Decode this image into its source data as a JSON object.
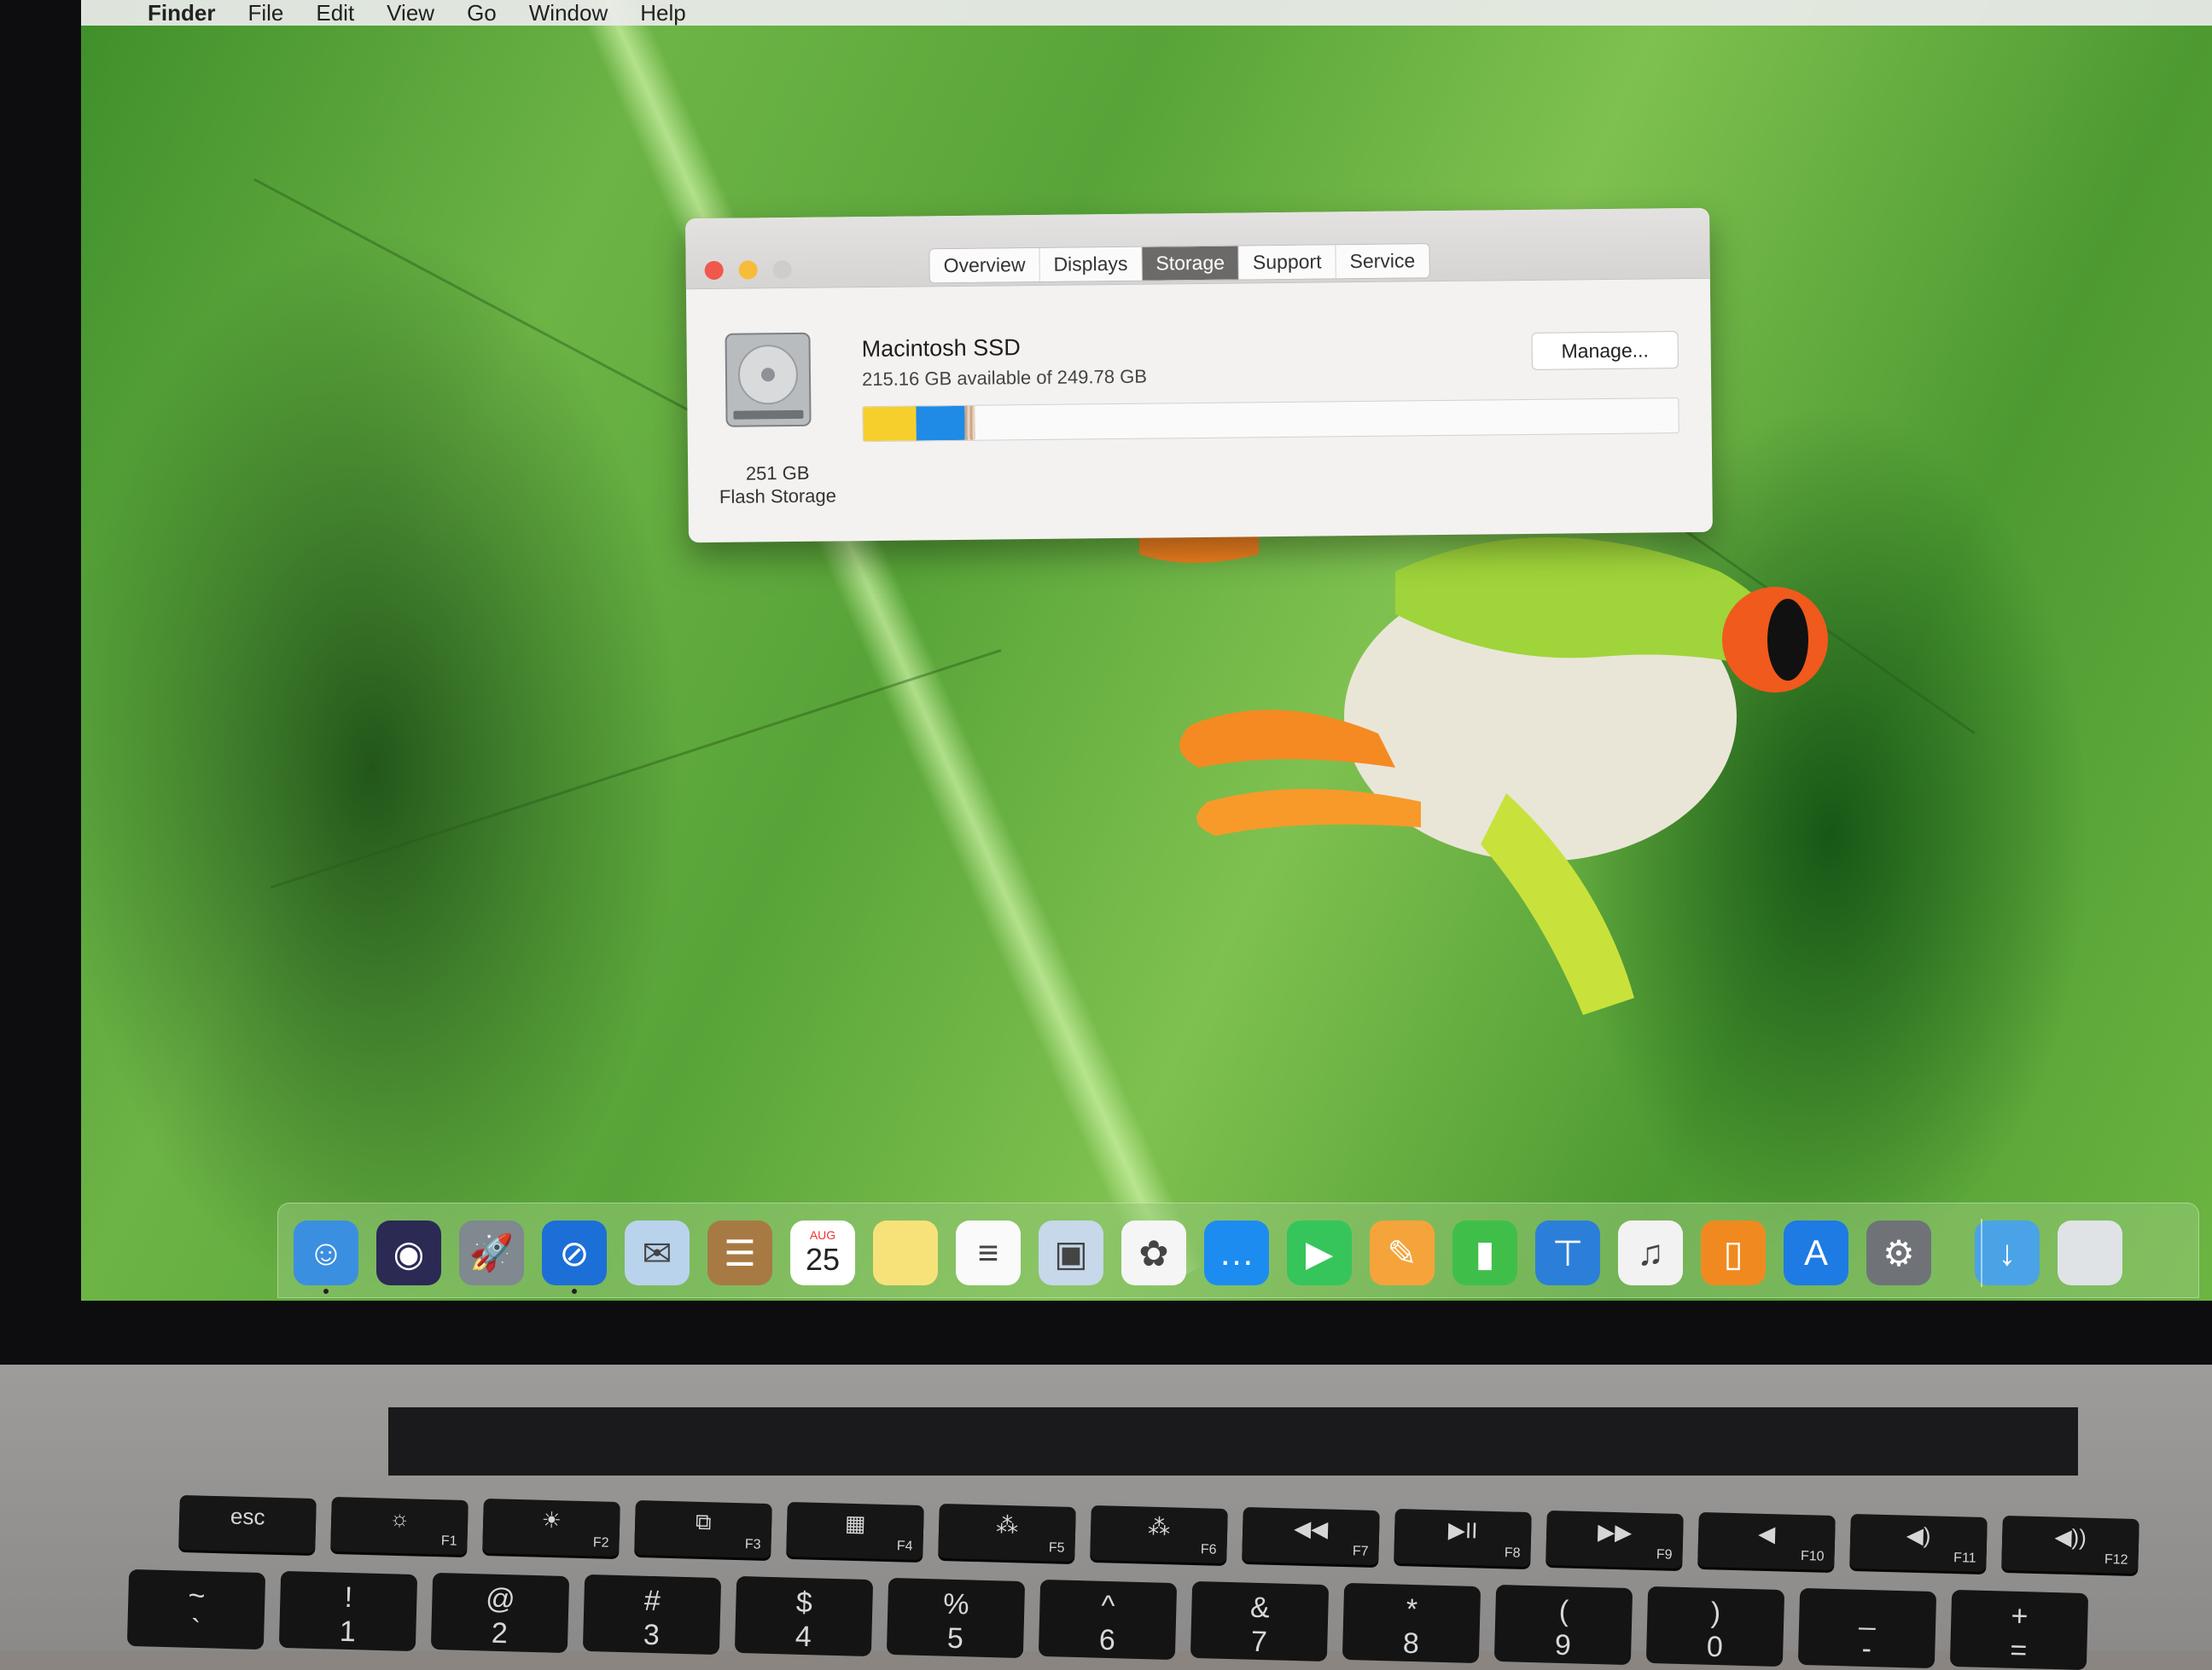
{
  "menubar": {
    "apple": "",
    "app_name": "Finder",
    "items": [
      "File",
      "Edit",
      "View",
      "Go",
      "Window",
      "Help"
    ]
  },
  "about_window": {
    "tabs": [
      "Overview",
      "Displays",
      "Storage",
      "Support",
      "Service"
    ],
    "active_tab": "Storage",
    "disk_size": "251 GB",
    "disk_type": "Flash Storage",
    "volume_name": "Macintosh SSD",
    "available_text": "215.16 GB available of 249.78 GB",
    "manage_label": "Manage...",
    "storage_usage": {
      "segments": [
        {
          "name": "yellow",
          "color": "#f7cf2d",
          "fraction": 0.065
        },
        {
          "name": "blue",
          "color": "#1f8be6",
          "fraction": 0.06
        },
        {
          "name": "other",
          "color": "#c9a98a",
          "fraction": 0.012
        }
      ],
      "free_fraction": 0.863
    }
  },
  "dock": {
    "apps": [
      {
        "name": "Finder",
        "icon": "finder-icon",
        "color": "#3b8fe0",
        "running": true
      },
      {
        "name": "Siri",
        "icon": "siri-icon",
        "color": "#2a2a55",
        "running": false
      },
      {
        "name": "Launchpad",
        "icon": "launchpad-icon",
        "color": "#808890",
        "running": false
      },
      {
        "name": "Safari",
        "icon": "safari-icon",
        "color": "#1c6fd6",
        "running": true
      },
      {
        "name": "Mail",
        "icon": "mail-icon",
        "color": "#b9d3ec",
        "running": false
      },
      {
        "name": "Contacts",
        "icon": "contacts-icon",
        "color": "#a87a43",
        "running": false
      },
      {
        "name": "Calendar",
        "icon": "calendar-icon",
        "color": "#ffffff",
        "running": false,
        "month": "AUG",
        "day": "25"
      },
      {
        "name": "Notes",
        "icon": "notes-icon",
        "color": "#f7e27a",
        "running": false
      },
      {
        "name": "Reminders",
        "icon": "reminders-icon",
        "color": "#fafafa",
        "running": false
      },
      {
        "name": "Photo Booth",
        "icon": "photobooth-icon",
        "color": "#c6d8ea",
        "running": false
      },
      {
        "name": "Photos",
        "icon": "photos-icon",
        "color": "#f5f5f5",
        "running": false
      },
      {
        "name": "Messages",
        "icon": "messages-icon",
        "color": "#1d8cf0",
        "running": false
      },
      {
        "name": "FaceTime",
        "icon": "facetime-icon",
        "color": "#36c55a",
        "running": false
      },
      {
        "name": "Pages",
        "icon": "pages-icon",
        "color": "#f4a43a",
        "running": false
      },
      {
        "name": "Numbers",
        "icon": "numbers-icon",
        "color": "#3fbf4a",
        "running": false
      },
      {
        "name": "Keynote",
        "icon": "keynote-icon",
        "color": "#2c7fd8",
        "running": false
      },
      {
        "name": "iTunes",
        "icon": "itunes-icon",
        "color": "#f2f2f2",
        "running": false
      },
      {
        "name": "iBooks",
        "icon": "ibooks-icon",
        "color": "#f08a20",
        "running": false
      },
      {
        "name": "App Store",
        "icon": "appstore-icon",
        "color": "#1e7be3",
        "running": false
      },
      {
        "name": "System Preferences",
        "icon": "systemprefs-icon",
        "color": "#6f7377",
        "running": false
      },
      {
        "name": "Downloads",
        "icon": "downloads-folder-icon",
        "color": "#4aa3e6",
        "running": false
      },
      {
        "name": "Trash",
        "icon": "trash-icon",
        "color": "#dfe3e6",
        "running": false
      }
    ]
  },
  "keyboard": {
    "function_row": [
      {
        "label": "esc",
        "fn": ""
      },
      {
        "label": "☼",
        "fn": "F1"
      },
      {
        "label": "☀",
        "fn": "F2"
      },
      {
        "label": "⧉",
        "fn": "F3"
      },
      {
        "label": "▦",
        "fn": "F4"
      },
      {
        "label": "⁂",
        "fn": "F5"
      },
      {
        "label": "⁂",
        "fn": "F6"
      },
      {
        "label": "◀◀",
        "fn": "F7"
      },
      {
        "label": "▶II",
        "fn": "F8"
      },
      {
        "label": "▶▶",
        "fn": "F9"
      },
      {
        "label": "◀",
        "fn": "F10"
      },
      {
        "label": "◀)",
        "fn": "F11"
      },
      {
        "label": "◀))",
        "fn": "F12"
      }
    ],
    "number_row": [
      {
        "top": "~",
        "bottom": "`"
      },
      {
        "top": "!",
        "bottom": "1"
      },
      {
        "top": "@",
        "bottom": "2"
      },
      {
        "top": "#",
        "bottom": "3"
      },
      {
        "top": "$",
        "bottom": "4"
      },
      {
        "top": "%",
        "bottom": "5"
      },
      {
        "top": "^",
        "bottom": "6"
      },
      {
        "top": "&",
        "bottom": "7"
      },
      {
        "top": "*",
        "bottom": "8"
      },
      {
        "top": "(",
        "bottom": "9"
      },
      {
        "top": ")",
        "bottom": "0"
      },
      {
        "top": "_",
        "bottom": "-"
      },
      {
        "top": "+",
        "bottom": "="
      }
    ]
  },
  "colors": {
    "close": "#f0584c",
    "minimize": "#f6bc3a",
    "zoom": "#cfcdcc",
    "active_tab": "#6c6a69"
  }
}
